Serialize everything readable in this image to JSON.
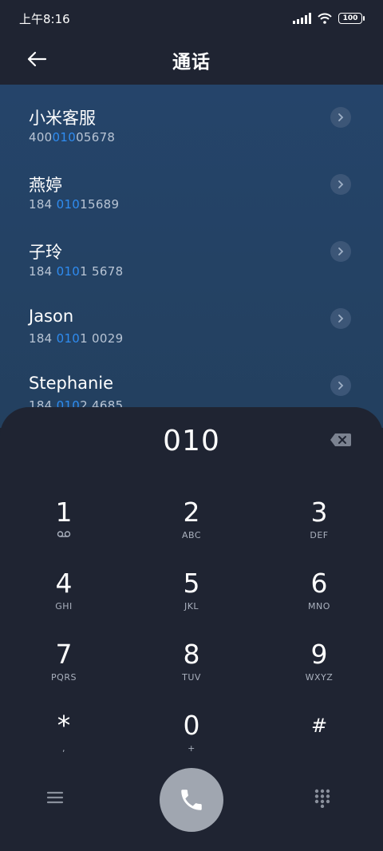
{
  "status": {
    "time": "上午8:16",
    "battery": "100"
  },
  "header": {
    "title": "通话"
  },
  "results": [
    {
      "name": "小米客服",
      "number_pre": "400",
      "number_hl": "010",
      "number_post": "05678"
    },
    {
      "name": "燕婷",
      "number_pre": "184 ",
      "number_hl": "010",
      "number_post": "15689"
    },
    {
      "name": "子玲",
      "number_pre": "184 ",
      "number_hl": "010",
      "number_post": "1 5678"
    },
    {
      "name": "Jason",
      "number_pre": "184 ",
      "number_hl": "010",
      "number_post": "1 0029"
    },
    {
      "name": "Stephanie",
      "number_pre": "184 ",
      "number_hl": "010",
      "number_post": "2 4685"
    }
  ],
  "dialer": {
    "input_value": "010",
    "keys": [
      {
        "digit": "1",
        "letters": ""
      },
      {
        "digit": "2",
        "letters": "ABC"
      },
      {
        "digit": "3",
        "letters": "DEF"
      },
      {
        "digit": "4",
        "letters": "GHI"
      },
      {
        "digit": "5",
        "letters": "JKL"
      },
      {
        "digit": "6",
        "letters": "MNO"
      },
      {
        "digit": "7",
        "letters": "PQRS"
      },
      {
        "digit": "8",
        "letters": "TUV"
      },
      {
        "digit": "9",
        "letters": "WXYZ"
      },
      {
        "digit": "*",
        "letters": ","
      },
      {
        "digit": "0",
        "letters": "+"
      },
      {
        "digit": "#",
        "letters": ""
      }
    ]
  },
  "colors": {
    "background": "#1f2432",
    "results_bg": "#25446a",
    "highlight": "#2f8cf0",
    "call_button": "#a0a6b0"
  },
  "icons": {
    "back": "arrow-left-icon",
    "chevron": "chevron-right-icon",
    "backspace": "backspace-icon",
    "voicemail": "voicemail-icon",
    "menu": "menu-icon",
    "call": "phone-icon",
    "keypad": "keypad-icon"
  }
}
